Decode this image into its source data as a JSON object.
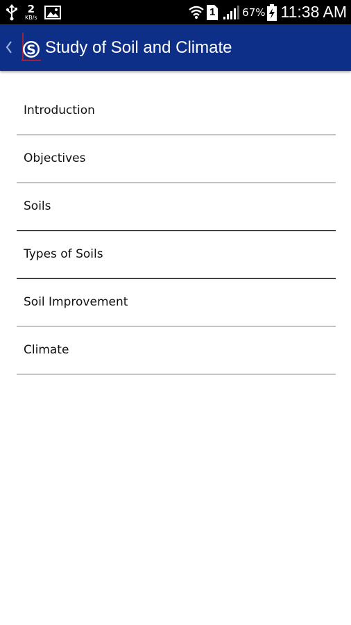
{
  "status_bar": {
    "left_icons": [
      "usb-icon",
      "data-speed-indicator",
      "image-notification-icon"
    ],
    "data_speed_value": "2",
    "data_speed_unit": "KB/s",
    "right_icons": [
      "wifi-icon",
      "sim-1-icon",
      "signal-icon",
      "battery-charging-icon"
    ],
    "sim_label": "1",
    "battery_percent": "67%",
    "time": "11:38 AM"
  },
  "app_bar": {
    "back_icon": "chevron-left-icon",
    "logo_icon": "app-logo-icon",
    "title": "Study of Soil and Climate",
    "background_color": "#0d2f88"
  },
  "menu": {
    "items": [
      {
        "label": "Introduction"
      },
      {
        "label": "Objectives"
      },
      {
        "label": "Soils"
      },
      {
        "label": "Types of Soils"
      },
      {
        "label": "Soil Improvement"
      },
      {
        "label": "Climate"
      }
    ]
  }
}
